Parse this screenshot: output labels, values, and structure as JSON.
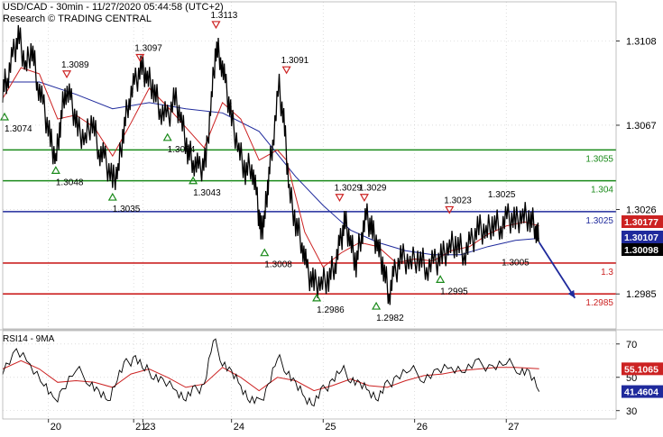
{
  "header": {
    "line1": "USD/CAD - 30min - 11/27/2020 05:44:58 (UTC+2)",
    "line2": "Research © TRADING CENTRAL"
  },
  "colors": {
    "price": "#000000",
    "ma_fast": "#cc2222",
    "ma_slow": "#1f2a9c",
    "support": "#1a8a1a",
    "pivot": "#1f2a9c",
    "resistance": "#cc2222",
    "arrow": "#1f2a9c",
    "grid": "#c8c8c8"
  },
  "chart_data": [
    {
      "type": "line",
      "name": "price",
      "ylim": [
        1.2968,
        1.3127
      ],
      "yticks": [
        "1.3108",
        "1.3067",
        "1.3026",
        "1.2985"
      ],
      "x_range": [
        0,
        6.7
      ],
      "x_ticks": [
        {
          "label": "20",
          "x": 0.5
        },
        {
          "label": "21",
          "x": 1.43
        },
        {
          "label": "23",
          "x": 1.53
        },
        {
          "label": "24",
          "x": 2.5
        },
        {
          "label": "25",
          "x": 3.5
        },
        {
          "label": "26",
          "x": 4.5
        },
        {
          "label": "27",
          "x": 5.5
        }
      ],
      "price_path": [
        [
          0.0,
          1.3085
        ],
        [
          0.05,
          1.309
        ],
        [
          0.12,
          1.3102
        ],
        [
          0.18,
          1.311
        ],
        [
          0.25,
          1.3095
        ],
        [
          0.32,
          1.3105
        ],
        [
          0.38,
          1.3088
        ],
        [
          0.45,
          1.3075
        ],
        [
          0.52,
          1.306
        ],
        [
          0.58,
          1.305
        ],
        [
          0.63,
          1.3068
        ],
        [
          0.68,
          1.3085
        ],
        [
          0.75,
          1.3078
        ],
        [
          0.82,
          1.3065
        ],
        [
          0.9,
          1.306
        ],
        [
          0.98,
          1.307
        ],
        [
          1.05,
          1.3055
        ],
        [
          1.12,
          1.305
        ],
        [
          1.2,
          1.304
        ],
        [
          1.26,
          1.3045
        ],
        [
          1.32,
          1.3065
        ],
        [
          1.38,
          1.308
        ],
        [
          1.45,
          1.3088
        ],
        [
          1.52,
          1.3095
        ],
        [
          1.58,
          1.309
        ],
        [
          1.65,
          1.3085
        ],
        [
          1.72,
          1.3075
        ],
        [
          1.8,
          1.307
        ],
        [
          1.88,
          1.308
        ],
        [
          1.95,
          1.307
        ],
        [
          2.02,
          1.3055
        ],
        [
          2.08,
          1.305
        ],
        [
          2.15,
          1.3045
        ],
        [
          2.22,
          1.305
        ],
        [
          2.28,
          1.308
        ],
        [
          2.33,
          1.3105
        ],
        [
          2.38,
          1.31
        ],
        [
          2.44,
          1.3085
        ],
        [
          2.5,
          1.307
        ],
        [
          2.58,
          1.3055
        ],
        [
          2.65,
          1.3045
        ],
        [
          2.72,
          1.3048
        ],
        [
          2.78,
          1.303
        ],
        [
          2.82,
          1.3015
        ],
        [
          2.86,
          1.3022
        ],
        [
          2.9,
          1.304
        ],
        [
          2.95,
          1.306
        ],
        [
          3.02,
          1.3085
        ],
        [
          3.08,
          1.3065
        ],
        [
          3.13,
          1.3035
        ],
        [
          3.2,
          1.302
        ],
        [
          3.27,
          1.301
        ],
        [
          3.33,
          1.2995
        ],
        [
          3.4,
          1.299
        ],
        [
          3.48,
          1.299
        ],
        [
          3.56,
          1.2993
        ],
        [
          3.63,
          1.3
        ],
        [
          3.69,
          1.301
        ],
        [
          3.74,
          1.302
        ],
        [
          3.8,
          1.301
        ],
        [
          3.86,
          1.3
        ],
        [
          3.92,
          1.3015
        ],
        [
          3.98,
          1.3022
        ],
        [
          4.04,
          1.3015
        ],
        [
          4.1,
          1.3008
        ],
        [
          4.16,
          1.2998
        ],
        [
          4.22,
          1.2985
        ],
        [
          4.28,
          1.2995
        ],
        [
          4.36,
          1.3003
        ],
        [
          4.45,
          1.3
        ],
        [
          4.55,
          1.3003
        ],
        [
          4.63,
          1.2998
        ],
        [
          4.72,
          1.3
        ],
        [
          4.8,
          1.3003
        ],
        [
          4.88,
          1.3008
        ],
        [
          4.96,
          1.301
        ],
        [
          5.04,
          1.3005
        ],
        [
          5.12,
          1.301
        ],
        [
          5.2,
          1.3017
        ],
        [
          5.28,
          1.3015
        ],
        [
          5.36,
          1.302
        ],
        [
          5.44,
          1.3018
        ],
        [
          5.52,
          1.3022
        ],
        [
          5.6,
          1.302
        ],
        [
          5.68,
          1.3023
        ],
        [
          5.76,
          1.3022
        ],
        [
          5.82,
          1.3018
        ],
        [
          5.86,
          1.301
        ]
      ],
      "ma_fast": [
        [
          0.0,
          1.308
        ],
        [
          0.2,
          1.3095
        ],
        [
          0.4,
          1.3092
        ],
        [
          0.6,
          1.307
        ],
        [
          0.8,
          1.3072
        ],
        [
          1.0,
          1.3066
        ],
        [
          1.2,
          1.3052
        ],
        [
          1.4,
          1.3068
        ],
        [
          1.6,
          1.3085
        ],
        [
          1.8,
          1.3076
        ],
        [
          2.0,
          1.3066
        ],
        [
          2.2,
          1.3056
        ],
        [
          2.4,
          1.3078
        ],
        [
          2.6,
          1.307
        ],
        [
          2.8,
          1.305
        ],
        [
          3.0,
          1.3055
        ],
        [
          3.1,
          1.305
        ],
        [
          3.3,
          1.3015
        ],
        [
          3.5,
          1.2998
        ],
        [
          3.7,
          1.3005
        ],
        [
          3.9,
          1.301
        ],
        [
          4.1,
          1.3008
        ],
        [
          4.3,
          1.3
        ],
        [
          4.5,
          1.3002
        ],
        [
          4.7,
          1.3001
        ],
        [
          4.9,
          1.3006
        ],
        [
          5.1,
          1.3008
        ],
        [
          5.3,
          1.3014
        ],
        [
          5.5,
          1.3018
        ],
        [
          5.7,
          1.302
        ],
        [
          5.86,
          1.3018
        ]
      ],
      "ma_slow": [
        [
          0.0,
          1.3088
        ],
        [
          0.4,
          1.3088
        ],
        [
          0.8,
          1.3082
        ],
        [
          1.2,
          1.3075
        ],
        [
          1.6,
          1.3078
        ],
        [
          2.0,
          1.3075
        ],
        [
          2.4,
          1.3073
        ],
        [
          2.8,
          1.3064
        ],
        [
          3.2,
          1.3042
        ],
        [
          3.5,
          1.3028
        ],
        [
          3.8,
          1.3016
        ],
        [
          4.1,
          1.301
        ],
        [
          4.4,
          1.3006
        ],
        [
          4.7,
          1.3004
        ],
        [
          5.0,
          1.3004
        ],
        [
          5.3,
          1.3008
        ],
        [
          5.6,
          1.3011
        ],
        [
          5.86,
          1.3012
        ]
      ],
      "levels": [
        {
          "value": 1.3055,
          "label": "1.3055",
          "kind": "support"
        },
        {
          "value": 1.304,
          "label": "1.304",
          "kind": "support"
        },
        {
          "value": 1.3025,
          "label": "1.3025",
          "kind": "pivot"
        },
        {
          "value": 1.3,
          "label": "1.3",
          "kind": "resistance"
        },
        {
          "value": 1.2985,
          "label": "1.2985",
          "kind": "resistance"
        }
      ],
      "price_tags": [
        {
          "value": 1.3017,
          "label": "1.30177",
          "style": "red"
        },
        {
          "value": 1.301,
          "label": "1.30107",
          "style": "blue"
        },
        {
          "value": 1.3009,
          "label": "1.30098",
          "style": "black"
        }
      ],
      "annotations": [
        {
          "text": "1.3074",
          "x": 0.02,
          "y": 1.3074,
          "dir": "up"
        },
        {
          "text": "1.3089",
          "x": 0.7,
          "y": 1.3089,
          "dir": "down"
        },
        {
          "text": "1.3048",
          "x": 0.58,
          "y": 1.3048,
          "dir": "up"
        },
        {
          "text": "1.3097",
          "x": 1.5,
          "y": 1.3097,
          "dir": "down"
        },
        {
          "text": "1.3035",
          "x": 1.2,
          "y": 1.3035,
          "dir": "up"
        },
        {
          "text": "1.3064",
          "x": 1.8,
          "y": 1.3064,
          "dir": "up"
        },
        {
          "text": "1.3113",
          "x": 2.33,
          "y": 1.3113,
          "dir": "down"
        },
        {
          "text": "1.3043",
          "x": 2.08,
          "y": 1.3043,
          "dir": "up"
        },
        {
          "text": "1.3091",
          "x": 3.1,
          "y": 1.3091,
          "dir": "down"
        },
        {
          "text": "1.3008",
          "x": 2.86,
          "y": 1.3008,
          "dir": "up"
        },
        {
          "text": "1.2986",
          "x": 3.43,
          "y": 1.2986,
          "dir": "up"
        },
        {
          "text": "1.3029",
          "x": 3.95,
          "y": 1.3029,
          "dir": "down"
        },
        {
          "text": "1.3029",
          "x": 3.68,
          "y": 1.3029,
          "dir": "down"
        },
        {
          "text": "1.2982",
          "x": 4.08,
          "y": 1.2982,
          "dir": "up"
        },
        {
          "text": "1.3023",
          "x": 4.88,
          "y": 1.3023,
          "dir": "down"
        },
        {
          "text": "1.2995",
          "x": 4.78,
          "y": 1.2995,
          "dir": "up"
        },
        {
          "text": "1.3025",
          "x": 5.3,
          "y": 1.3025,
          "dir": "label"
        },
        {
          "text": "1.3005",
          "x": 5.45,
          "y": 1.3005,
          "dir": "label"
        }
      ],
      "forecast_arrow": {
        "from": [
          5.86,
          1.301
        ],
        "to": [
          6.25,
          1.2983
        ]
      }
    },
    {
      "type": "line",
      "title": "RSI14 - 9MA",
      "ylim": [
        25,
        78
      ],
      "yticks": [
        "70",
        "50",
        "30"
      ],
      "rsi_path": [
        [
          0.0,
          55
        ],
        [
          0.15,
          65
        ],
        [
          0.3,
          58
        ],
        [
          0.45,
          47
        ],
        [
          0.55,
          35
        ],
        [
          0.65,
          42
        ],
        [
          0.8,
          55
        ],
        [
          0.95,
          48
        ],
        [
          1.05,
          40
        ],
        [
          1.15,
          36
        ],
        [
          1.25,
          50
        ],
        [
          1.35,
          58
        ],
        [
          1.45,
          62
        ],
        [
          1.55,
          55
        ],
        [
          1.65,
          52
        ],
        [
          1.75,
          47
        ],
        [
          1.9,
          42
        ],
        [
          2.0,
          38
        ],
        [
          2.1,
          42
        ],
        [
          2.2,
          45
        ],
        [
          2.3,
          73
        ],
        [
          2.4,
          60
        ],
        [
          2.5,
          52
        ],
        [
          2.6,
          45
        ],
        [
          2.7,
          37
        ],
        [
          2.8,
          34
        ],
        [
          2.9,
          45
        ],
        [
          3.0,
          62
        ],
        [
          3.1,
          55
        ],
        [
          3.2,
          45
        ],
        [
          3.3,
          38
        ],
        [
          3.4,
          35
        ],
        [
          3.5,
          42
        ],
        [
          3.6,
          48
        ],
        [
          3.7,
          55
        ],
        [
          3.8,
          50
        ],
        [
          3.9,
          45
        ],
        [
          4.0,
          42
        ],
        [
          4.1,
          38
        ],
        [
          4.2,
          45
        ],
        [
          4.3,
          50
        ],
        [
          4.45,
          55
        ],
        [
          4.6,
          50
        ],
        [
          4.75,
          53
        ],
        [
          4.9,
          56
        ],
        [
          5.05,
          55
        ],
        [
          5.2,
          58
        ],
        [
          5.35,
          56
        ],
        [
          5.5,
          59
        ],
        [
          5.65,
          55
        ],
        [
          5.75,
          52
        ],
        [
          5.86,
          41.4604
        ]
      ],
      "rsi_ma_path": [
        [
          0.0,
          55
        ],
        [
          0.2,
          60
        ],
        [
          0.4,
          55
        ],
        [
          0.6,
          47
        ],
        [
          0.8,
          48
        ],
        [
          1.0,
          47
        ],
        [
          1.2,
          44
        ],
        [
          1.4,
          52
        ],
        [
          1.6,
          55
        ],
        [
          1.8,
          50
        ],
        [
          2.0,
          44
        ],
        [
          2.2,
          46
        ],
        [
          2.4,
          56
        ],
        [
          2.6,
          50
        ],
        [
          2.8,
          42
        ],
        [
          3.0,
          50
        ],
        [
          3.2,
          48
        ],
        [
          3.4,
          42
        ],
        [
          3.6,
          45
        ],
        [
          3.8,
          49
        ],
        [
          4.0,
          45
        ],
        [
          4.2,
          44
        ],
        [
          4.4,
          48
        ],
        [
          4.6,
          51
        ],
        [
          4.8,
          52
        ],
        [
          5.0,
          54
        ],
        [
          5.2,
          55
        ],
        [
          5.4,
          56
        ],
        [
          5.6,
          56
        ],
        [
          5.86,
          55.1065
        ]
      ],
      "tags": [
        {
          "value": 55.1065,
          "label": "55.1065",
          "style": "red"
        },
        {
          "value": 41.4604,
          "label": "41.4604",
          "style": "blue"
        }
      ]
    }
  ]
}
